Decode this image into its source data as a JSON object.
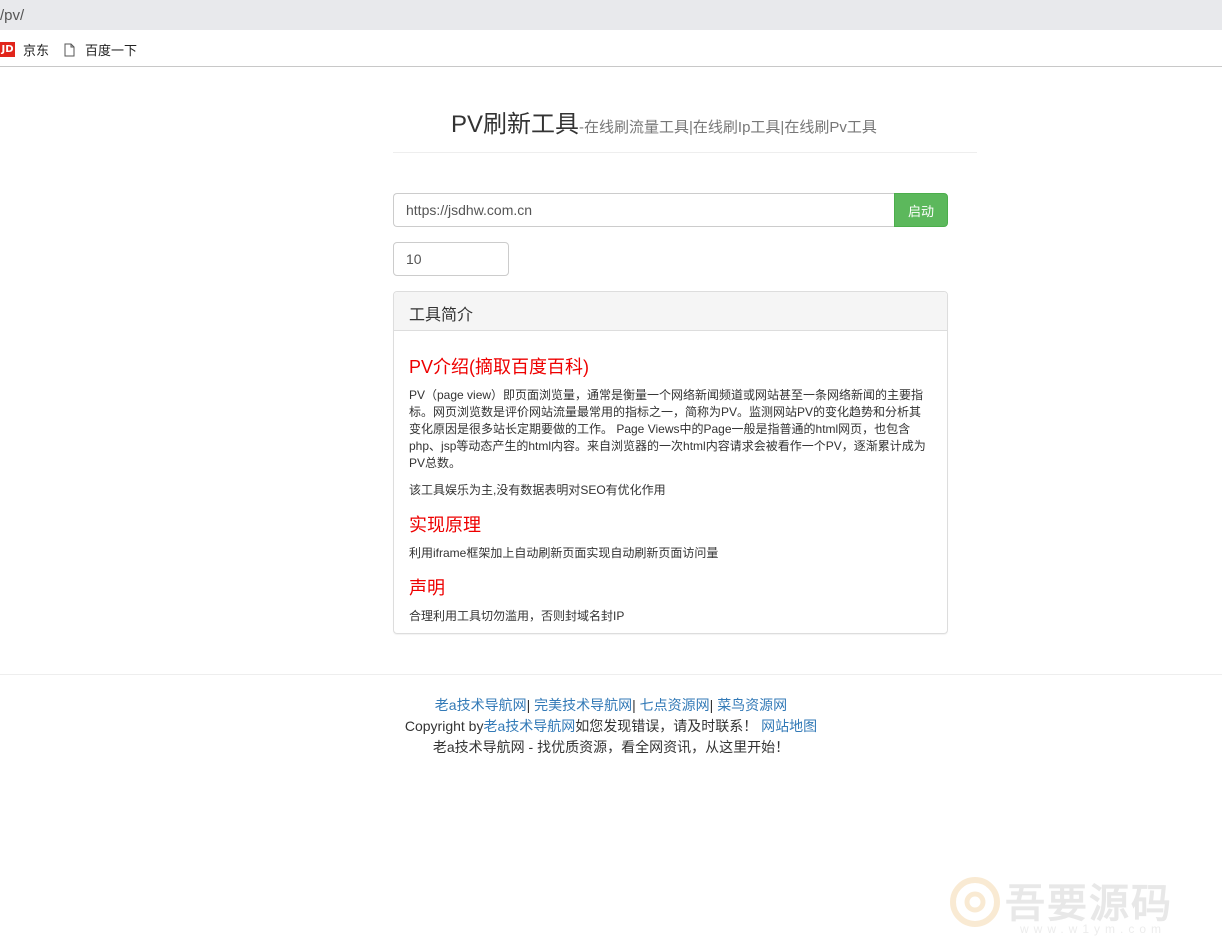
{
  "browser": {
    "url": "/pv/",
    "bookmarks": [
      {
        "label": "京东",
        "icon": "jd-logo-icon"
      },
      {
        "label": "百度一下",
        "icon": "page-icon"
      }
    ]
  },
  "header": {
    "title": "PV刷新工具",
    "subtitle": "-在线刷流量工具|在线刷Ip工具|在线刷Pv工具"
  },
  "form": {
    "url_value": "https://jsdhw.com.cn",
    "start_label": "启动",
    "count_value": "10"
  },
  "panel": {
    "heading": "工具简介",
    "sections": [
      {
        "title": "PV介绍(摘取百度百科)",
        "paragraphs": [
          "PV（page view）即页面浏览量，通常是衡量一个网络新闻频道或网站甚至一条网络新闻的主要指标。网页浏览数是评价网站流量最常用的指标之一，简称为PV。监测网站PV的变化趋势和分析其变化原因是很多站长定期要做的工作。 Page Views中的Page一般是指普通的html网页，也包含php、jsp等动态产生的html内容。来自浏览器的一次html内容请求会被看作一个PV，逐渐累计成为PV总数。",
          "该工具娱乐为主,没有数据表明对SEO有优化作用"
        ]
      },
      {
        "title": "实现原理",
        "paragraphs": [
          "利用iframe框架加上自动刷新页面实现自动刷新页面访问量"
        ]
      },
      {
        "title": "声明",
        "paragraphs": [
          "合理利用工具切勿滥用，否则封域名封IP"
        ]
      }
    ]
  },
  "footer": {
    "links": [
      "老a技术导航网",
      "完美技术导航网",
      "七点资源网",
      "菜鸟资源网"
    ],
    "copyright_prefix": "Copyright by",
    "copyright_link": "老a技术导航网",
    "copyright_mid": "如您发现错误，请及时联系！",
    "sitemap": "网站地图",
    "slogan": "老a技术导航网 - 找优质资源，看全网资讯，从这里开始！"
  },
  "watermark": {
    "text": "吾要源码",
    "sub": "www.w1ym.com"
  },
  "colors": {
    "accent_green": "#5cb85c",
    "section_red": "#e00000",
    "link_blue": "#337ab7"
  }
}
